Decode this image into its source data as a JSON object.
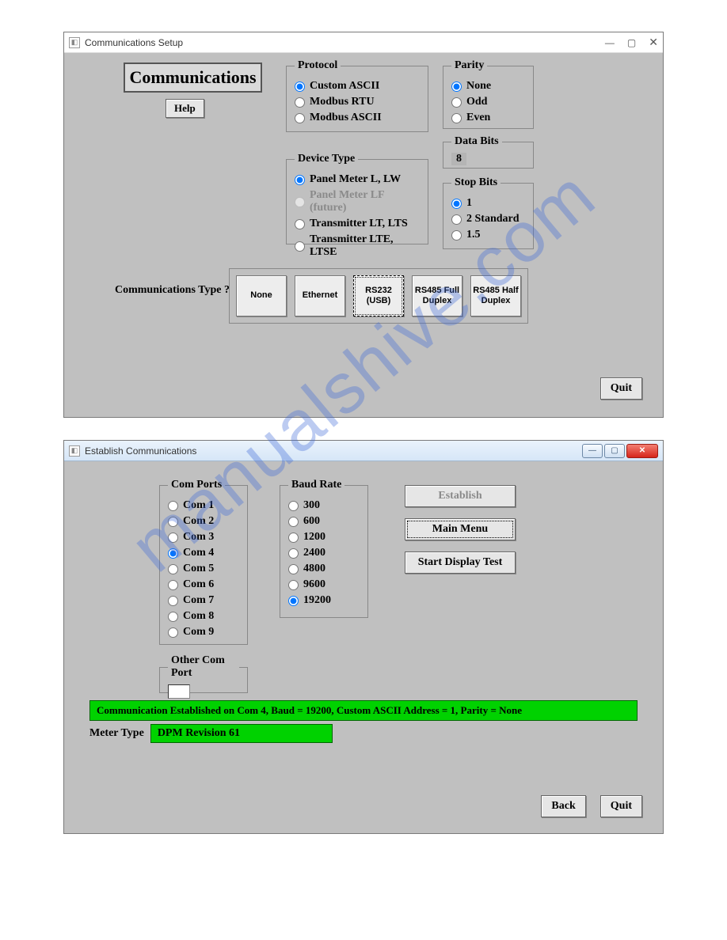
{
  "watermark": "manualshive.com",
  "window1": {
    "title": "Communications Setup",
    "winctl": {
      "min": "—",
      "max": "▢",
      "close": "✕"
    },
    "heading": "Communications",
    "help_label": "Help",
    "protocol": {
      "legend": "Protocol",
      "opts": [
        "Custom ASCII",
        "Modbus RTU",
        "Modbus ASCII"
      ],
      "selected": 0
    },
    "device": {
      "legend": "Device Type",
      "opts": [
        {
          "label": "Panel Meter  L, LW",
          "disabled": false
        },
        {
          "label": "Panel Meter  LF (future)",
          "disabled": true
        },
        {
          "label": "Transmitter  LT, LTS",
          "disabled": false
        },
        {
          "label": "Transmitter  LTE, LTSE",
          "disabled": false
        }
      ],
      "selected": 0
    },
    "parity": {
      "legend": "Parity",
      "opts": [
        "None",
        "Odd",
        "Even"
      ],
      "selected": 0
    },
    "databits": {
      "legend": "Data Bits",
      "value": "8"
    },
    "stopbits": {
      "legend": "Stop Bits",
      "opts": [
        "1",
        "2 Standard",
        "1.5"
      ],
      "selected": 0
    },
    "commtype_label": "Communications Type ?",
    "commtypes": [
      {
        "label": "None",
        "selected": false
      },
      {
        "label": "Ethernet",
        "selected": false
      },
      {
        "label": "RS232 (USB)",
        "selected": true
      },
      {
        "label": "RS485 Full Duplex",
        "selected": false
      },
      {
        "label": "RS485 Half Duplex",
        "selected": false
      }
    ],
    "quit_label": "Quit"
  },
  "window2": {
    "title": "Establish Communications",
    "comports": {
      "legend": "Com Ports",
      "opts": [
        "Com 1",
        "Com 2",
        "Com 3",
        "Com 4",
        "Com 5",
        "Com 6",
        "Com 7",
        "Com 8",
        "Com 9"
      ],
      "selected": 3
    },
    "baud": {
      "legend": "Baud Rate",
      "opts": [
        "300",
        "600",
        "1200",
        "2400",
        "4800",
        "9600",
        "19200"
      ],
      "selected": 6
    },
    "other": {
      "legend": "Other Com Port",
      "value": ""
    },
    "buttons": {
      "establish": "Establish",
      "main_menu": "Main Menu",
      "display_test": "Start Display Test",
      "back": "Back",
      "quit": "Quit"
    },
    "status": "Communication Established on Com  4, Baud = 19200, Custom ASCII Address = 1, Parity = None",
    "meter_label": "Meter Type",
    "meter_value": "DPM Revision 61"
  }
}
